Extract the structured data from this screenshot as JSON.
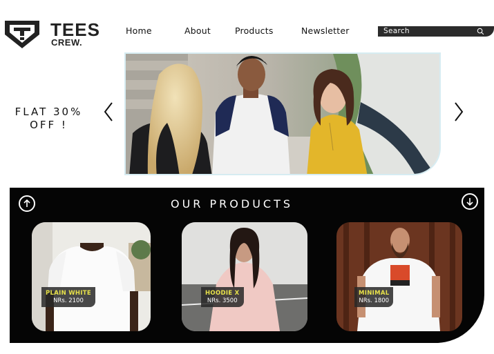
{
  "brand": {
    "line1": "TEES",
    "line2": "CREW."
  },
  "nav": {
    "items": [
      {
        "label": "Home"
      },
      {
        "label": "About"
      },
      {
        "label": "Products"
      },
      {
        "label": "Newsletter"
      }
    ]
  },
  "search": {
    "placeholder": "Search",
    "icon": "search-icon"
  },
  "hero": {
    "promo_line1": "FLAT 30%",
    "promo_line2": "OFF !",
    "prev_icon": "chevron-left-icon",
    "next_icon": "chevron-right-icon"
  },
  "products_section": {
    "title": "OUR PRODUCTS",
    "up_icon": "arrow-up-circle-icon",
    "down_icon": "arrow-down-circle-icon",
    "products": [
      {
        "name": "PLAIN WHITE",
        "price": "NRs. 2100"
      },
      {
        "name": "HOODIE X",
        "price": "NRs. 3500"
      },
      {
        "name": "MINIMAL",
        "price": "NRs. 1800"
      }
    ]
  },
  "colors": {
    "accent_yellow": "#e8e24a",
    "panel_bg": "#050505",
    "search_bg": "#2b2b2b",
    "hero_border": "#d6ecf2"
  }
}
